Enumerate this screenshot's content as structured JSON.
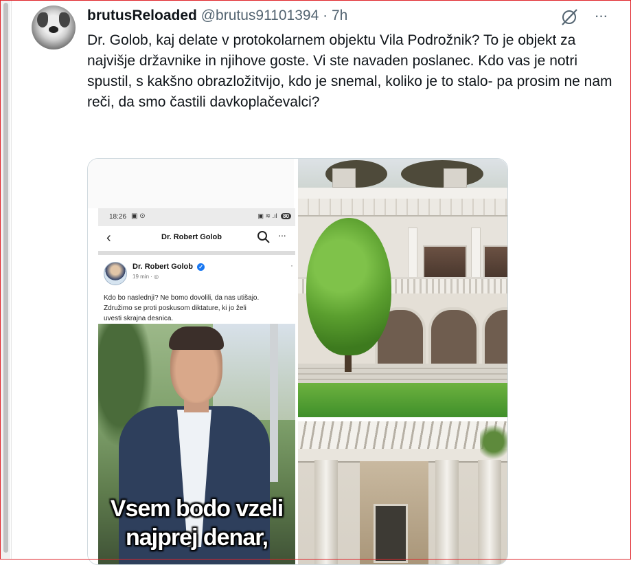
{
  "tweet": {
    "author": "brutusReloaded",
    "handle": "@brutus91101394",
    "separator": "·",
    "time": "7h",
    "text": "Dr. Golob, kaj delate v protokolarnem objektu Vila Podrožnik? To je objekt za najvišje državnike in njihove goste. Vi ste navaden poslanec. Kdo vas je notri spustil, s kakšno obrazložitvijo, kdo je snemal, koliko je to stalo- pa prosim ne nam reči, da smo častili davkoplačevalci?",
    "more_label": "···"
  },
  "icons": {
    "avatar": "bulldog-avatar",
    "grok": "grok-slash-icon",
    "more": "more-dots-icon"
  },
  "screenshot": {
    "status_time": "18:26",
    "status_icons": "▣ ⊙",
    "status_right": "▣ ≋ .ıl",
    "battery": "80",
    "back_glyph": "‹",
    "page_title": "Dr. Robert Golob",
    "more_glyph": "···",
    "post_name": "Dr. Robert Golob",
    "verified_glyph": "✓",
    "post_meta": "19 min · ◎",
    "post_dots": "·",
    "post_body": "Kdo bo naslednji? Ne bomo dovolili, da nas utišajo.\nZdružimo se proti poskusom diktature, ki jo želi\nuvesti skrajna desnica.",
    "caption_line1": "Vsem bodo vzeli",
    "caption_line2": "najprej denar,"
  },
  "colors": {
    "text": "#0f1419",
    "secondary": "#536471",
    "border": "#cfd9de",
    "frame": "#e0242a",
    "fb_blue": "#1877f2"
  }
}
